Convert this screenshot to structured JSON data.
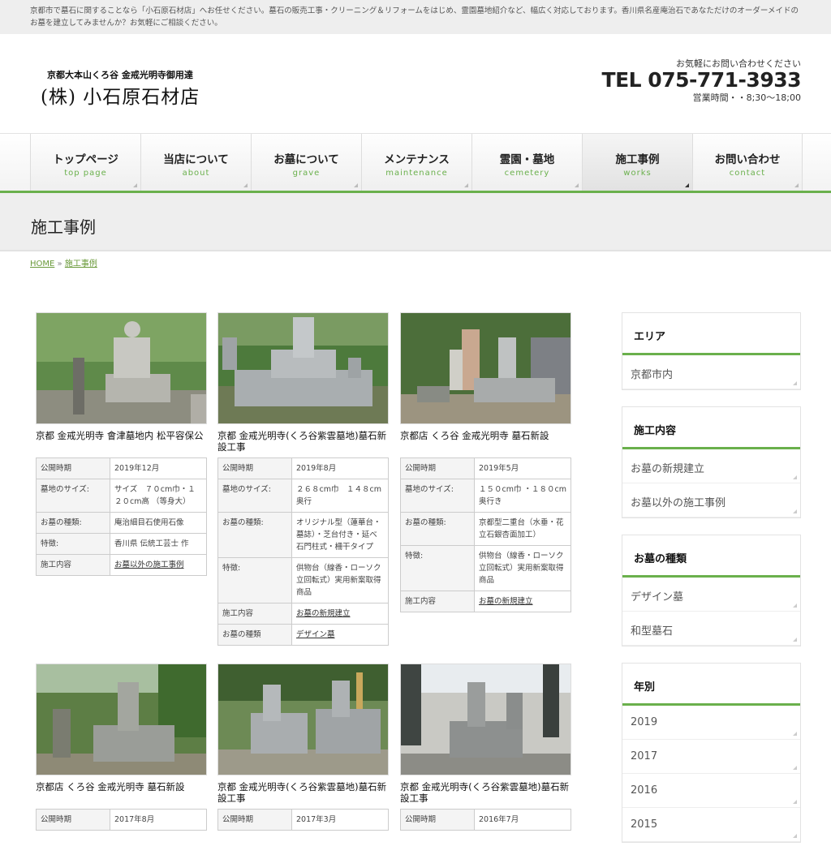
{
  "topbar": {
    "text": "京都市で墓石に関することなら「小石原石材店」へお任せください。墓石の販売工事・クリーニング＆リフォームをはじめ、霊園墓地紹介など、幅広く対応しております。香川県名産庵治石であなただけのオーダーメイドのお墓を建立してみませんか？お気軽にご相談ください。"
  },
  "header": {
    "logo_sub": "京都大本山くろ谷 金戒光明寺御用達",
    "logo_main": "(株) 小石原石材店",
    "contact_note": "お気軽にお問い合わせください",
    "tel": "TEL 075-771-3933",
    "hours": "営業時間・・8;30〜18;00"
  },
  "nav": [
    {
      "jp": "トップページ",
      "en": "top page"
    },
    {
      "jp": "当店について",
      "en": "about"
    },
    {
      "jp": "お墓について",
      "en": "grave"
    },
    {
      "jp": "メンテナンス",
      "en": "maintenance"
    },
    {
      "jp": "霊園・墓地",
      "en": "cemetery"
    },
    {
      "jp": "施工事例",
      "en": "works"
    },
    {
      "jp": "お問い合わせ",
      "en": "contact"
    }
  ],
  "page_title": "施工事例",
  "breadcrumb": {
    "home": "HOME",
    "sep": "»",
    "current": "施工事例"
  },
  "labels": {
    "date": "公開時期",
    "size": "墓地のサイズ:",
    "type": "お墓の種類:",
    "feature": "特徴:",
    "work": "施工内容",
    "kind": "お墓の種類"
  },
  "cards": [
    {
      "title": "京都 金戒光明寺 會津墓地内 松平容保公",
      "date": "2019年12月",
      "size": "サイズ　７０cm巾・１２０cm高 （等身大）",
      "type": "庵治細目石使用石像",
      "feature": "香川県 伝統工芸士 作",
      "work": "お墓以外の施工事例"
    },
    {
      "title": "京都 金戒光明寺(くろ谷紫雲墓地)墓石新設工事",
      "date": "2019年8月",
      "size": "２６８cm巾　１４８cm奥行",
      "type": "オリジナル型（蓮華台・墓誌）・芝台付き・延べ石門柱式・柵干タイプ",
      "feature": "供物台（線香・ローソク立回転式）実用新案取得商品",
      "work": "お墓の新規建立",
      "kind": "デザイン墓"
    },
    {
      "title": "京都店 くろ谷 金戒光明寺 墓石新設",
      "date": "2019年5月",
      "size": "１５０cm巾 ・１８０cm奥行き",
      "type": "京都型二重台（水垂・花立石銀杏面加工）",
      "feature": "供物台（線香・ローソク立回転式）実用新案取得商品",
      "work": "お墓の新規建立"
    },
    {
      "title": "京都店 くろ谷 金戒光明寺 墓石新設",
      "date": "2017年8月"
    },
    {
      "title": "京都 金戒光明寺(くろ谷紫雲墓地)墓石新設工事",
      "date": "2017年3月"
    },
    {
      "title": "京都 金戒光明寺(くろ谷紫雲墓地)墓石新設工事",
      "date": "2016年7月"
    }
  ],
  "sidebar": [
    {
      "title": "エリア",
      "items": [
        "京都市内"
      ]
    },
    {
      "title": "施工内容",
      "items": [
        "お墓の新規建立",
        "お墓以外の施工事例"
      ]
    },
    {
      "title": "お墓の種類",
      "items": [
        "デザイン墓",
        "和型墓石"
      ]
    },
    {
      "title": "年別",
      "items": [
        "2019",
        "2017",
        "2016",
        "2015"
      ]
    }
  ],
  "colors": {
    "accent": "#6ab04c",
    "nav_en": "#6ab04c",
    "bg_gray": "#eeeeee"
  }
}
